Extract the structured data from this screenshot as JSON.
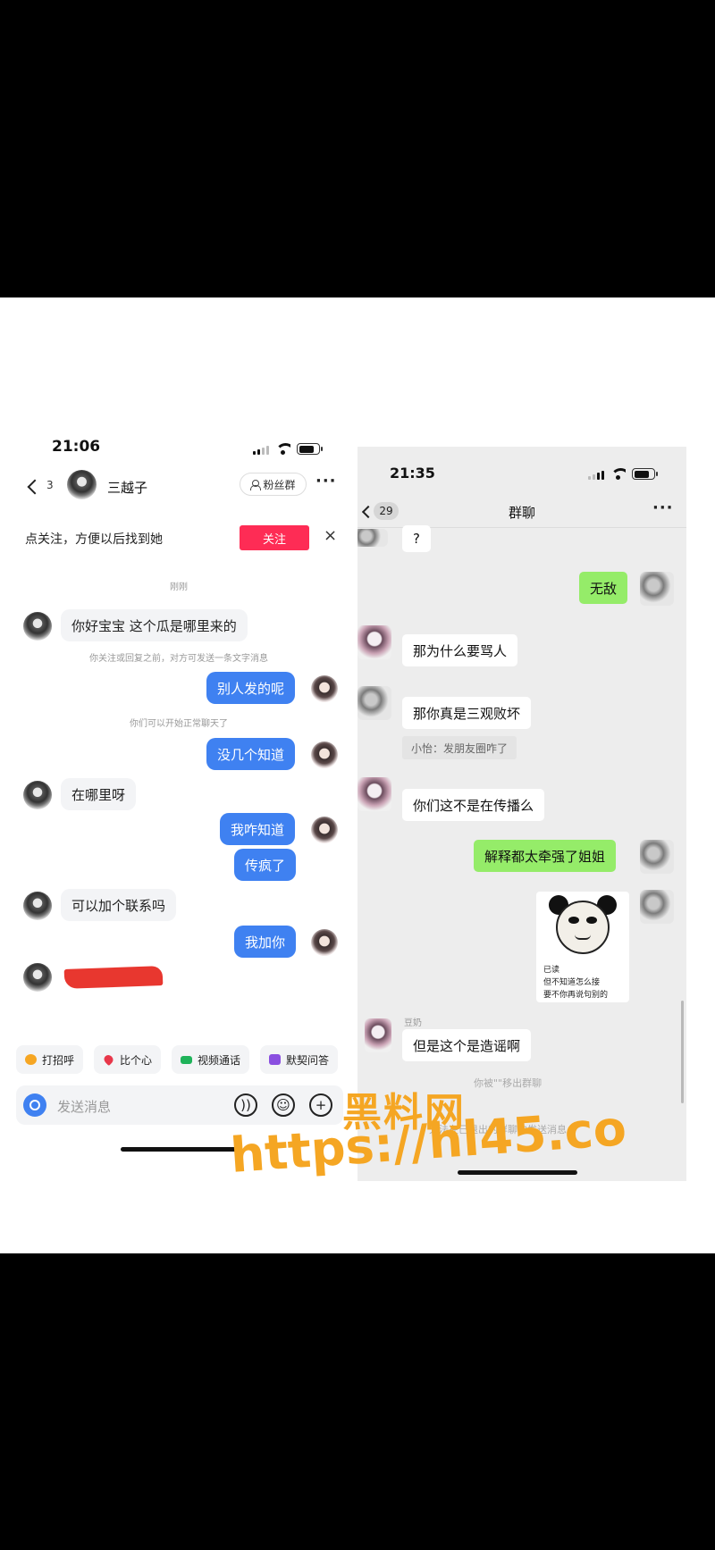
{
  "left_chat": {
    "status_time": "21:06",
    "back_count": "3",
    "contact_name": "三越子",
    "fans_group_label": "粉丝群",
    "more_label": "···",
    "follow_prompt": "点关注，方便以后找到她",
    "follow_button": "关注",
    "close_label": "×",
    "time_divider": "刚刚",
    "notice_1": "你关注或回复之前，对方可发送一条文字消息",
    "notice_2": "你们可以开始正常聊天了",
    "messages": [
      {
        "side": "in",
        "text": "你好宝宝 这个瓜是哪里来的"
      },
      {
        "side": "out",
        "text": "别人发的呢"
      },
      {
        "side": "out",
        "text": "没几个知道"
      },
      {
        "side": "in",
        "text": "在哪里呀"
      },
      {
        "side": "out",
        "text": "我咋知道"
      },
      {
        "side": "out",
        "text": "传疯了"
      },
      {
        "side": "in",
        "text": "可以加个联系吗"
      },
      {
        "side": "out",
        "text": "我加你"
      }
    ],
    "quick_actions": [
      "打招呼",
      "比个心",
      "视频通话",
      "默契问答"
    ],
    "input_placeholder": "发送消息",
    "input_icons": [
      "voice-icon",
      "emoji-icon",
      "plus-icon"
    ]
  },
  "right_chat": {
    "status_time": "21:35",
    "back_badge": "29",
    "title": "群聊",
    "more_label": "···",
    "messages": [
      {
        "side": "in",
        "text": "?"
      },
      {
        "side": "out",
        "text": "无敌"
      },
      {
        "side": "in",
        "text": "那为什么要骂人"
      },
      {
        "side": "in",
        "text": "那你真是三观败坏"
      },
      {
        "side": "in",
        "text": "你们这不是在传播么"
      },
      {
        "side": "out",
        "text": "解释都太牵强了姐姐"
      },
      {
        "side": "in",
        "text": "但是这个是造谣啊"
      }
    ],
    "quote_text": "小怡：发朋友圈咋了",
    "sticker_captions": [
      "已读",
      "但不知道怎么接",
      "要不你再说句别的"
    ],
    "sender_nick": "豆奶",
    "system_removed": "你被\"\"移出群聊",
    "system_cannot_send": "无法在已退出的群聊中发送消息"
  },
  "watermark": {
    "line1": "黑料网",
    "line2": "https://hl45.co"
  },
  "colors": {
    "dy_follow_red": "#fe2c55",
    "dy_bubble_blue": "#3f81f1",
    "wx_bubble_green": "#95ec69",
    "watermark_orange": "#f5a623"
  }
}
